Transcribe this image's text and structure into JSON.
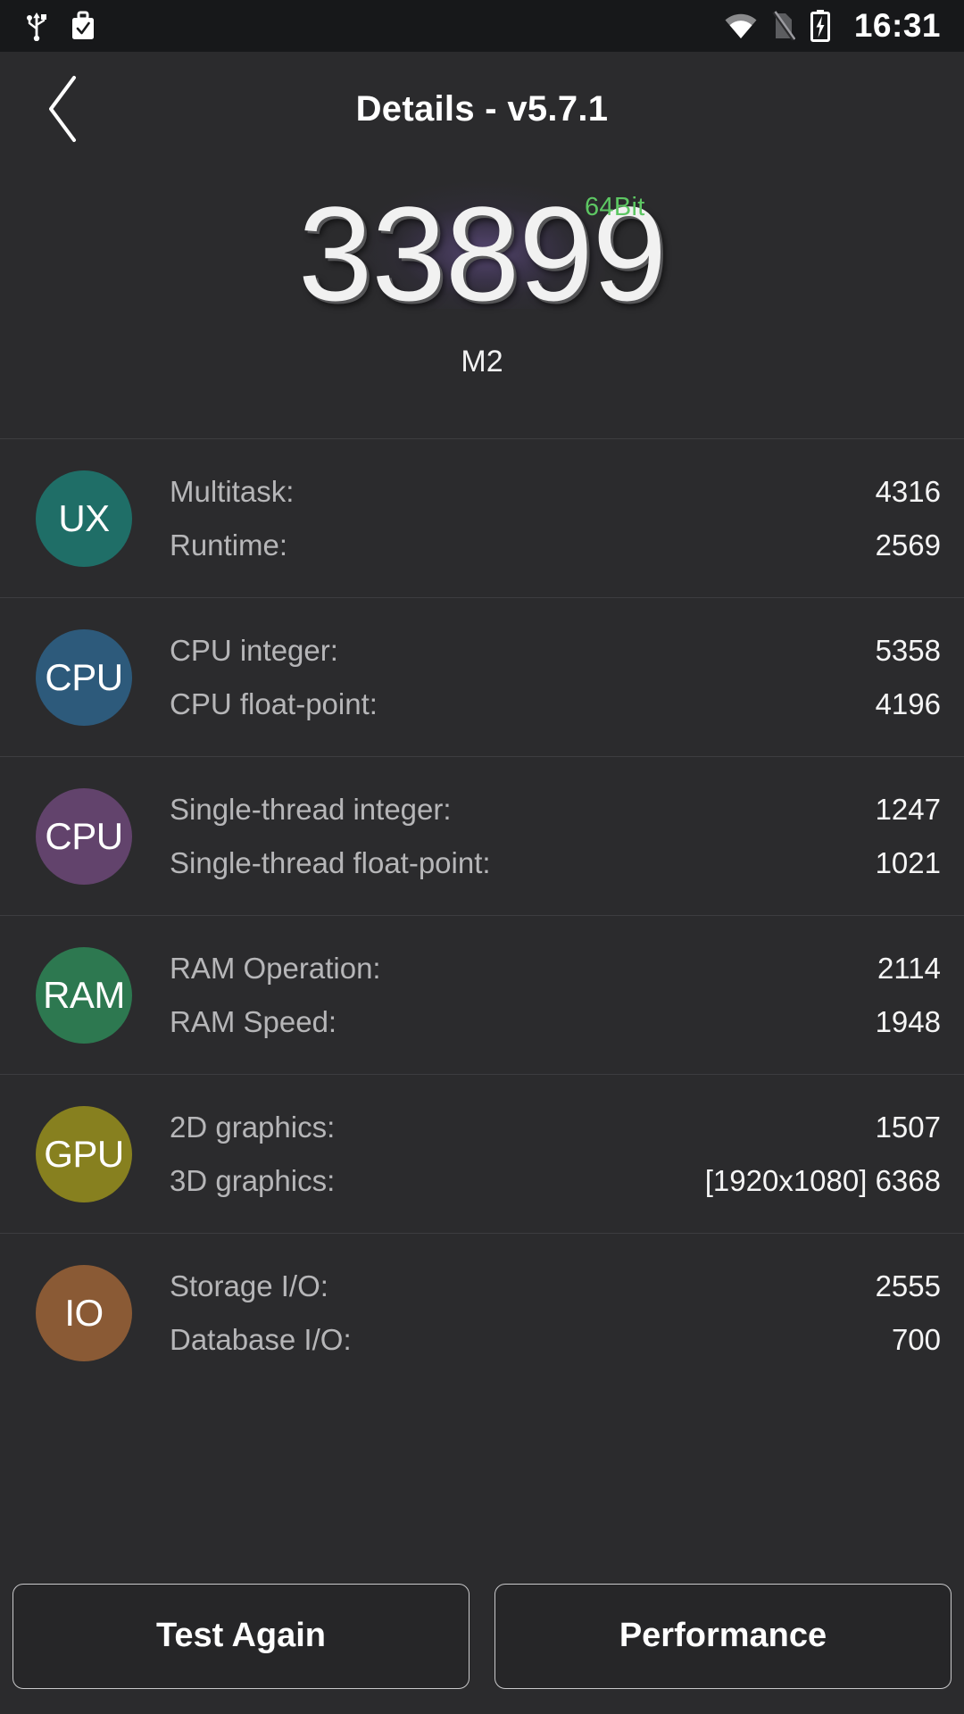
{
  "statusbar": {
    "time": "16:31",
    "icons": [
      "usb-icon",
      "work-profile-icon",
      "wifi-icon",
      "sim-off-icon",
      "battery-charging-icon"
    ]
  },
  "header": {
    "back_icon": "chevron-left-icon",
    "title": "Details - v5.7.1"
  },
  "score": {
    "total": "33899",
    "bit_badge": "64Bit",
    "device": "M2",
    "badge_color": "#5dc763",
    "glow_color": "#785ca8"
  },
  "benchmarks": [
    {
      "badge": "UX",
      "color": "#1f6e67",
      "metrics": [
        {
          "label": "Multitask:",
          "value": "4316"
        },
        {
          "label": "Runtime:",
          "value": "2569"
        }
      ]
    },
    {
      "badge": "CPU",
      "color": "#2d5a7b",
      "metrics": [
        {
          "label": "CPU integer:",
          "value": "5358"
        },
        {
          "label": "CPU float-point:",
          "value": "4196"
        }
      ]
    },
    {
      "badge": "CPU",
      "color": "#62436c",
      "metrics": [
        {
          "label": "Single-thread integer:",
          "value": "1247"
        },
        {
          "label": "Single-thread float-point:",
          "value": "1021"
        }
      ]
    },
    {
      "badge": "RAM",
      "color": "#2d7850",
      "metrics": [
        {
          "label": "RAM Operation:",
          "value": "2114"
        },
        {
          "label": "RAM Speed:",
          "value": "1948"
        }
      ]
    },
    {
      "badge": "GPU",
      "color": "#87801f",
      "metrics": [
        {
          "label": "2D graphics:",
          "value": "1507"
        },
        {
          "label": "3D graphics:",
          "value": "[1920x1080] 6368"
        }
      ]
    },
    {
      "badge": "IO",
      "color": "#8a5a35",
      "metrics": [
        {
          "label": "Storage I/O:",
          "value": "2555"
        },
        {
          "label": "Database I/O:",
          "value": "700"
        }
      ]
    }
  ],
  "buttons": {
    "test_again": "Test Again",
    "performance": "Performance"
  }
}
